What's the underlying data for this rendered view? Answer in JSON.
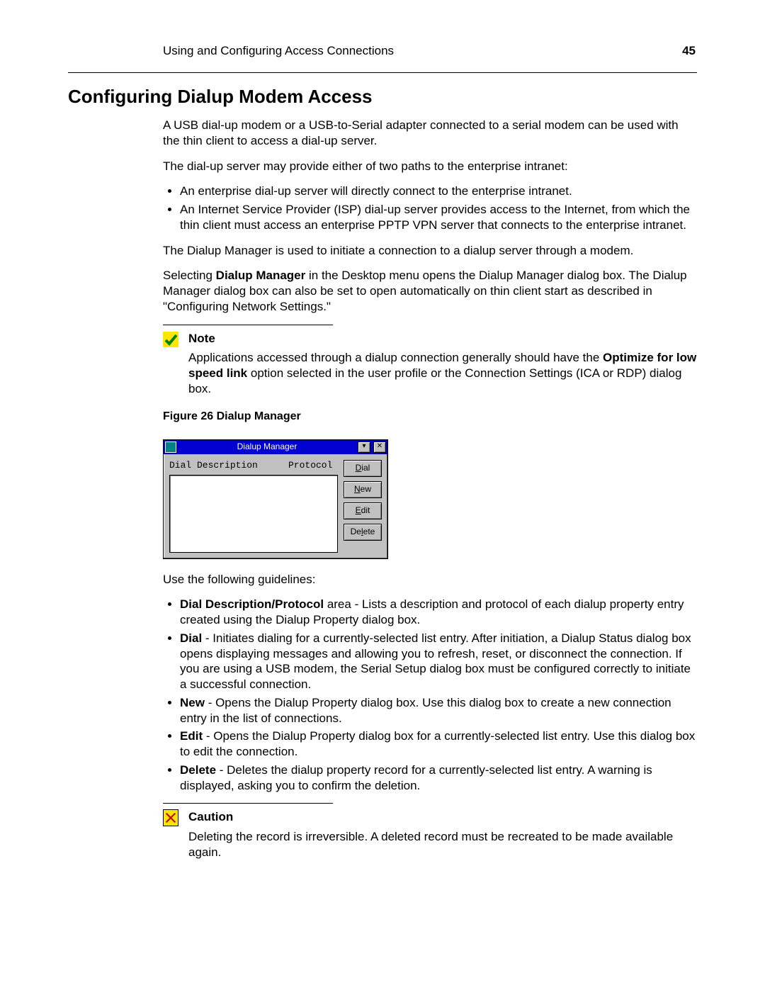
{
  "header": {
    "running_title": "Using and Configuring Access Connections",
    "page_number": "45"
  },
  "section_heading": "Configuring Dialup Modem Access",
  "intro_p1": "A USB dial-up modem or a USB-to-Serial adapter connected to a serial modem can be used with the thin client to access a dial-up server.",
  "intro_p2": "The dial-up server may provide either of two paths to the enterprise intranet:",
  "intro_bullets": [
    "An enterprise dial-up server will directly connect to the enterprise intranet.",
    "An Internet Service Provider (ISP) dial-up server provides access to the Internet, from which the thin client must access an enterprise PPTP VPN server that connects to the enterprise intranet."
  ],
  "manager_p1": "The Dialup Manager is used to initiate a connection to a dialup server through a modem.",
  "manager_p2_pre": "Selecting ",
  "manager_p2_bold": "Dialup Manager",
  "manager_p2_post": " in the Desktop menu opens the Dialup Manager dialog box. The Dialup Manager dialog box can also be set to open automatically on thin client start as described in \"Configuring Network Settings.\"",
  "note": {
    "label": "Note",
    "text_pre": "Applications accessed through a dialup connection generally should have the ",
    "text_bold": "Optimize for low speed link",
    "text_post": " option selected in the user profile or the Connection Settings (ICA or RDP) dialog box."
  },
  "figure_caption": "Figure 26    Dialup Manager",
  "dialog": {
    "title": "Dialup  Manager",
    "min_label": "▾",
    "close_label": "✕",
    "col1": "Dial Description",
    "col2": "Protocol",
    "buttons": {
      "dial": "Dial",
      "new": "New",
      "edit": "Edit",
      "delete": "Delete"
    }
  },
  "guidelines_intro": "Use the following guidelines:",
  "guidelines": [
    {
      "bold": "Dial Description/Protocol",
      "rest": " area - Lists a description and protocol of each dialup property entry created using the Dialup Property dialog box."
    },
    {
      "bold": "Dial",
      "rest": " - Initiates dialing for a currently-selected list entry. After initiation, a Dialup Status dialog box opens displaying messages and allowing you to refresh, reset, or disconnect the connection. If you are using a USB modem, the Serial Setup dialog box must be configured correctly to initiate a successful connection."
    },
    {
      "bold": "New",
      "rest": " - Opens the Dialup Property dialog box. Use this dialog box to create a new connection entry in the list of connections."
    },
    {
      "bold": "Edit",
      "rest": " - Opens the Dialup Property dialog box for a currently-selected list entry. Use this dialog box to edit the connection."
    },
    {
      "bold": "Delete",
      "rest": " - Deletes the dialup property record for a currently-selected list entry. A warning is displayed, asking you to confirm the deletion."
    }
  ],
  "caution": {
    "label": "Caution",
    "text": "Deleting the record is irreversible. A deleted record must be recreated to be made available again."
  }
}
